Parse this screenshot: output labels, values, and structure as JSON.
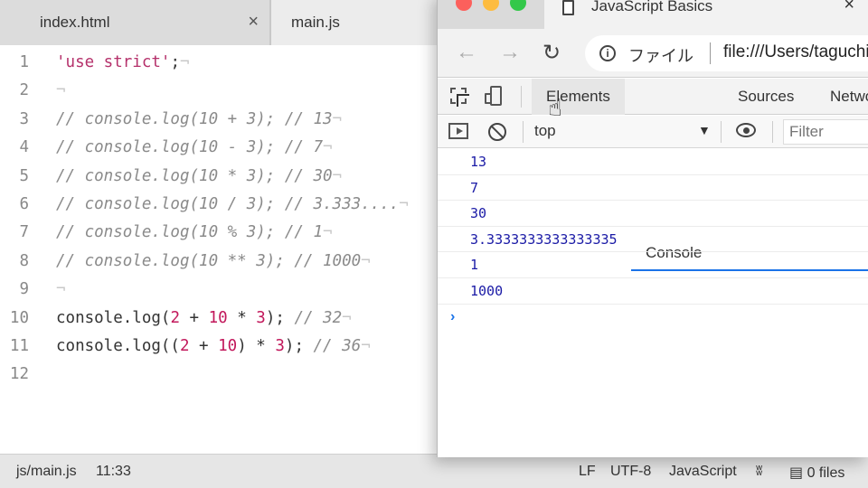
{
  "editor": {
    "tabs": [
      {
        "label": "index.html",
        "close": "×"
      },
      {
        "label": "main.js"
      }
    ],
    "lines": [
      {
        "n": "1",
        "parts": [
          {
            "t": "'use strict'",
            "c": "str"
          },
          {
            "t": ";",
            "c": "plain"
          },
          {
            "t": "¬",
            "c": "eol"
          }
        ]
      },
      {
        "n": "2",
        "parts": [
          {
            "t": "¬",
            "c": "eol"
          }
        ]
      },
      {
        "n": "3",
        "parts": [
          {
            "t": "// console.log(10 + 3); // 13",
            "c": "comment"
          },
          {
            "t": "¬",
            "c": "eol"
          }
        ]
      },
      {
        "n": "4",
        "parts": [
          {
            "t": "// console.log(10 - 3); // 7",
            "c": "comment"
          },
          {
            "t": "¬",
            "c": "eol"
          }
        ]
      },
      {
        "n": "5",
        "parts": [
          {
            "t": "// console.log(10 * 3); // 30",
            "c": "comment"
          },
          {
            "t": "¬",
            "c": "eol"
          }
        ]
      },
      {
        "n": "6",
        "parts": [
          {
            "t": "// console.log(10 / 3); // 3.333....",
            "c": "comment"
          },
          {
            "t": "¬",
            "c": "eol"
          }
        ]
      },
      {
        "n": "7",
        "parts": [
          {
            "t": "// console.log(10 % 3); // 1",
            "c": "comment"
          },
          {
            "t": "¬",
            "c": "eol"
          }
        ]
      },
      {
        "n": "8",
        "parts": [
          {
            "t": "// console.log(10 ** 3); // 1000",
            "c": "comment"
          },
          {
            "t": "¬",
            "c": "eol"
          }
        ]
      },
      {
        "n": "9",
        "parts": [
          {
            "t": "¬",
            "c": "eol"
          }
        ]
      },
      {
        "n": "10",
        "parts": [
          {
            "t": "console.log(",
            "c": "plain"
          },
          {
            "t": "2",
            "c": "num"
          },
          {
            "t": " + ",
            "c": "plain"
          },
          {
            "t": "10",
            "c": "num"
          },
          {
            "t": " * ",
            "c": "plain"
          },
          {
            "t": "3",
            "c": "num"
          },
          {
            "t": "); ",
            "c": "plain"
          },
          {
            "t": "// 32",
            "c": "comment"
          },
          {
            "t": "¬",
            "c": "eol"
          }
        ]
      },
      {
        "n": "11",
        "parts": [
          {
            "t": "console.log((",
            "c": "plain"
          },
          {
            "t": "2",
            "c": "num"
          },
          {
            "t": " + ",
            "c": "plain"
          },
          {
            "t": "10",
            "c": "num"
          },
          {
            "t": ") * ",
            "c": "plain"
          },
          {
            "t": "3",
            "c": "num"
          },
          {
            "t": "); ",
            "c": "plain"
          },
          {
            "t": "// 36",
            "c": "comment"
          },
          {
            "t": "¬",
            "c": "eol"
          }
        ]
      },
      {
        "n": "12",
        "parts": []
      }
    ]
  },
  "statusbar": {
    "file": "js/main.js",
    "position": "11:33",
    "line_ending": "LF",
    "encoding": "UTF-8",
    "grammar": "JavaScript",
    "files": "0 files"
  },
  "browser": {
    "tab_title": "JavaScript Basics",
    "tab_close": "×",
    "back": "←",
    "forward": "→",
    "reload": "↻",
    "info": "i",
    "security_label": "ファイル",
    "url": "file:///Users/taguchi/",
    "devtools": {
      "tabs": {
        "elements": "Elements",
        "console": "Console",
        "sources": "Sources",
        "network": "Network"
      },
      "context": "top",
      "caret": "▼",
      "filter_placeholder": "Filter",
      "cursor": "☝"
    },
    "console_messages": [
      "13",
      "7",
      "30",
      "3.3333333333333335",
      "1",
      "1000"
    ],
    "prompt": "›"
  },
  "colors": {
    "console_value": "#1a1aa6",
    "comment": "#8a8a8a",
    "number": "#c2185b",
    "string": "#b5316b",
    "accent": "#1a73e8"
  }
}
